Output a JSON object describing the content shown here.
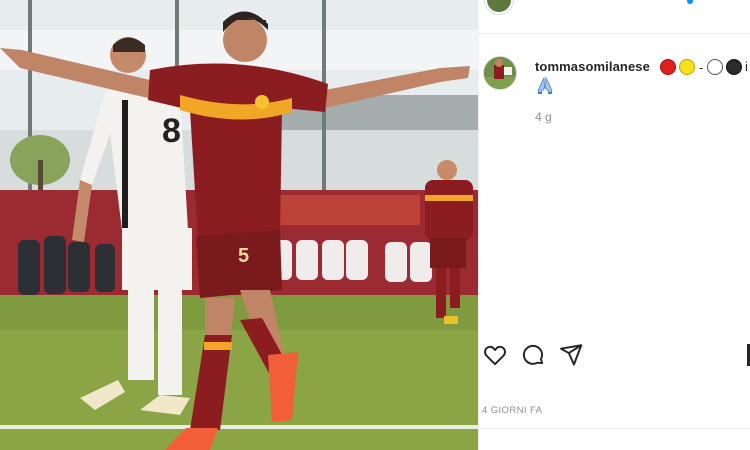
{
  "post": {
    "username": "tommasomilanese",
    "caption_emojis": [
      "red-circle",
      "yellow-circle",
      "dash",
      "white-circle",
      "black-circle"
    ],
    "caption_dash": "-",
    "caption_trail": "i",
    "caption_second_line_emoji": "folded-hands",
    "relative_time": "4 g",
    "full_time": "4 GIORNI FA"
  },
  "photo": {
    "jersey_number_player": "5",
    "jersey_number_opponent": "8",
    "kit_colors": {
      "home_shirt": "#8b1c20",
      "home_trim": "#f2a626",
      "away_shirt": "#f4f2ee"
    }
  },
  "actions": {
    "like": "heart-icon",
    "comment": "comment-icon",
    "share": "paper-plane-icon",
    "save": "bookmark-icon"
  },
  "colors": {
    "username": "#262626",
    "timestamp": "#8e8e8e",
    "divider": "#efefef",
    "red_emoji": "#e0201d",
    "yellow_emoji": "#f6e019",
    "white_emoji": "#ffffff",
    "black_emoji": "#2b2b2b"
  }
}
